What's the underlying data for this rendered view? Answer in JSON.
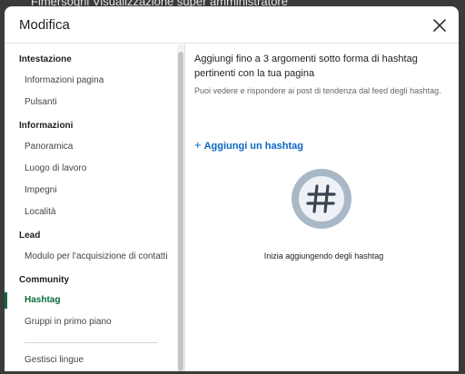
{
  "backdrop": {
    "text": "Fimersogni  Visualizzazione super amministratore"
  },
  "modal": {
    "title": "Modifica",
    "close_icon": "close-icon"
  },
  "sidebar": {
    "sections": [
      {
        "title": "Intestazione",
        "items": [
          "Informazioni pagina",
          "Pulsanti"
        ]
      },
      {
        "title": "Informazioni",
        "items": [
          "Panoramica",
          "Luogo di lavoro",
          "Impegni",
          "Località"
        ]
      },
      {
        "title": "Lead",
        "items": [
          "Modulo per l'acquisizione di contatti"
        ]
      },
      {
        "title": "Community",
        "items": [
          "Hashtag",
          "Gruppi in primo piano"
        ]
      }
    ],
    "active_item": "Hashtag",
    "footer_item": "Gestisci lingue",
    "active_color": "#0a6b3a"
  },
  "main": {
    "heading": "Aggiungi fino a 3 argomenti sotto forma di hashtag pertinenti con la tua pagina",
    "subtext": "Puoi vedere e rispondere ai post di tendenza dal feed degli hashtag.",
    "add_button": "Aggiungi un hashtag",
    "add_icon": "plus-icon",
    "illustration_icon": "hashtag-icon",
    "empty_state": "Inizia aggiungendo degli hashtag",
    "link_color": "#0a66c2"
  }
}
